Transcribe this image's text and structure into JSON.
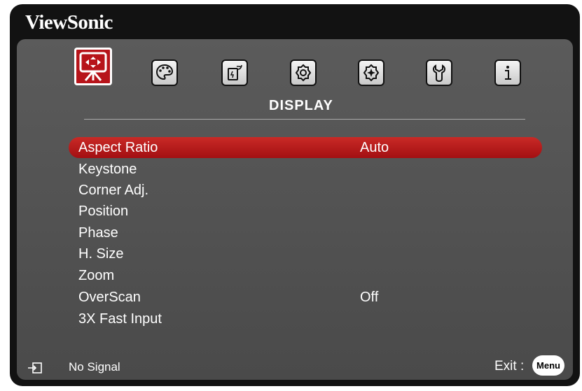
{
  "brand": {
    "name": "ViewSonic"
  },
  "tabs": [
    {
      "icon": "display-icon",
      "active": true
    },
    {
      "icon": "picture-palette-icon",
      "active": false
    },
    {
      "icon": "power-management-icon",
      "active": false
    },
    {
      "icon": "basic-settings-icon",
      "active": false
    },
    {
      "icon": "advanced-settings-icon",
      "active": false
    },
    {
      "icon": "system-wrench-icon",
      "active": false
    },
    {
      "icon": "information-icon",
      "active": false
    }
  ],
  "section": {
    "title": "DISPLAY"
  },
  "menu": {
    "items": [
      {
        "label": "Aspect Ratio",
        "value": "Auto",
        "selected": true
      },
      {
        "label": "Keystone",
        "value": ""
      },
      {
        "label": "Corner Adj.",
        "value": ""
      },
      {
        "label": "Position",
        "value": ""
      },
      {
        "label": "Phase",
        "value": ""
      },
      {
        "label": "H. Size",
        "value": ""
      },
      {
        "label": "Zoom",
        "value": ""
      },
      {
        "label": "OverScan",
        "value": "Off"
      },
      {
        "label": "3X Fast Input",
        "value": ""
      }
    ]
  },
  "footer": {
    "signal_icon": "input-source-icon",
    "signal_text": "No Signal",
    "exit_label": "Exit :",
    "menu_button": "Menu"
  },
  "colors": {
    "selection": "#b7141a",
    "panel": "#545454",
    "frame": "#121212"
  }
}
